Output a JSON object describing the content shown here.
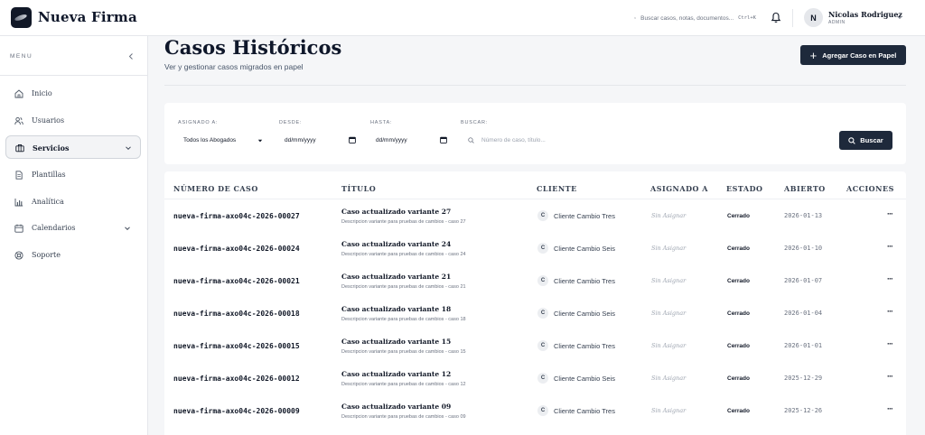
{
  "app": {
    "brand": "Nueva Firma"
  },
  "topbar": {
    "search_placeholder": "Buscar casos, notas, documentos...",
    "search_shortcut": "Ctrl+K",
    "user": {
      "initial": "N",
      "name": "Nicolas Rodriguez",
      "role": "ADMIN"
    }
  },
  "sidebar": {
    "menu_label": "MENU",
    "items": [
      {
        "label": "Inicio",
        "icon": "home-icon"
      },
      {
        "label": "Usuarios",
        "icon": "users-icon"
      },
      {
        "label": "Servicios",
        "icon": "briefcase-icon",
        "active": true,
        "expandable": true
      },
      {
        "label": "Plantillas",
        "icon": "file-icon"
      },
      {
        "label": "Analítica",
        "icon": "bar-chart-icon"
      },
      {
        "label": "Calendarios",
        "icon": "calendar-icon",
        "expandable": true
      },
      {
        "label": "Soporte",
        "icon": "lifebuoy-icon"
      }
    ]
  },
  "main": {
    "title": "Casos Históricos",
    "subtitle": "Ver y gestionar casos migrados en papel",
    "add_button": "Agregar Caso en Papel"
  },
  "filters": {
    "assigned_label": "ASIGNADO A:",
    "assigned_value": "Todos los Abogados",
    "from_label": "DESDE:",
    "from_placeholder": "dd/mm/yyyy",
    "to_label": "HASTA:",
    "to_placeholder": "dd/mm/yyyy",
    "search_label": "BUSCAR:",
    "search_placeholder": "Número de caso, título...",
    "search_button": "Buscar"
  },
  "table": {
    "columns": [
      "NÚMERO DE CASO",
      "TÍTULO",
      "CLIENTE",
      "ASIGNADO A",
      "ESTADO",
      "ABIERTO",
      "ACCIONES"
    ],
    "rows": [
      {
        "number": "nueva-firma-axo04c-2026-00027",
        "title": "Caso actualizado variante 27",
        "desc": "Descripcion variante para pruebas de cambios - caso 27",
        "client_initial": "C",
        "client": "Cliente Cambio Tres",
        "assigned": "Sin Asignar",
        "state": "Cerrado",
        "opened": "2026-01-13"
      },
      {
        "number": "nueva-firma-axo04c-2026-00024",
        "title": "Caso actualizado variante 24",
        "desc": "Descripcion variante para pruebas de cambios - caso 24",
        "client_initial": "C",
        "client": "Cliente Cambio Seis",
        "assigned": "Sin Asignar",
        "state": "Cerrado",
        "opened": "2026-01-10"
      },
      {
        "number": "nueva-firma-axo04c-2026-00021",
        "title": "Caso actualizado variante 21",
        "desc": "Descripcion variante para pruebas de cambios - caso 21",
        "client_initial": "C",
        "client": "Cliente Cambio Tres",
        "assigned": "Sin Asignar",
        "state": "Cerrado",
        "opened": "2026-01-07"
      },
      {
        "number": "nueva-firma-axo04c-2026-00018",
        "title": "Caso actualizado variante 18",
        "desc": "Descripcion variante para pruebas de cambios - caso 18",
        "client_initial": "C",
        "client": "Cliente Cambio Seis",
        "assigned": "Sin Asignar",
        "state": "Cerrado",
        "opened": "2026-01-04"
      },
      {
        "number": "nueva-firma-axo04c-2026-00015",
        "title": "Caso actualizado variante 15",
        "desc": "Descripcion variante para pruebas de cambios - caso 15",
        "client_initial": "C",
        "client": "Cliente Cambio Tres",
        "assigned": "Sin Asignar",
        "state": "Cerrado",
        "opened": "2026-01-01"
      },
      {
        "number": "nueva-firma-axo04c-2026-00012",
        "title": "Caso actualizado variante 12",
        "desc": "Descripcion variante para pruebas de cambios - caso 12",
        "client_initial": "C",
        "client": "Cliente Cambio Seis",
        "assigned": "Sin Asignar",
        "state": "Cerrado",
        "opened": "2025-12-29"
      },
      {
        "number": "nueva-firma-axo04c-2026-00009",
        "title": "Caso actualizado variante 09",
        "desc": "Descripcion variante para pruebas de cambios - caso 09",
        "client_initial": "C",
        "client": "Cliente Cambio Tres",
        "assigned": "Sin Asignar",
        "state": "Cerrado",
        "opened": "2025-12-26"
      }
    ],
    "actions_glyph": "···"
  }
}
